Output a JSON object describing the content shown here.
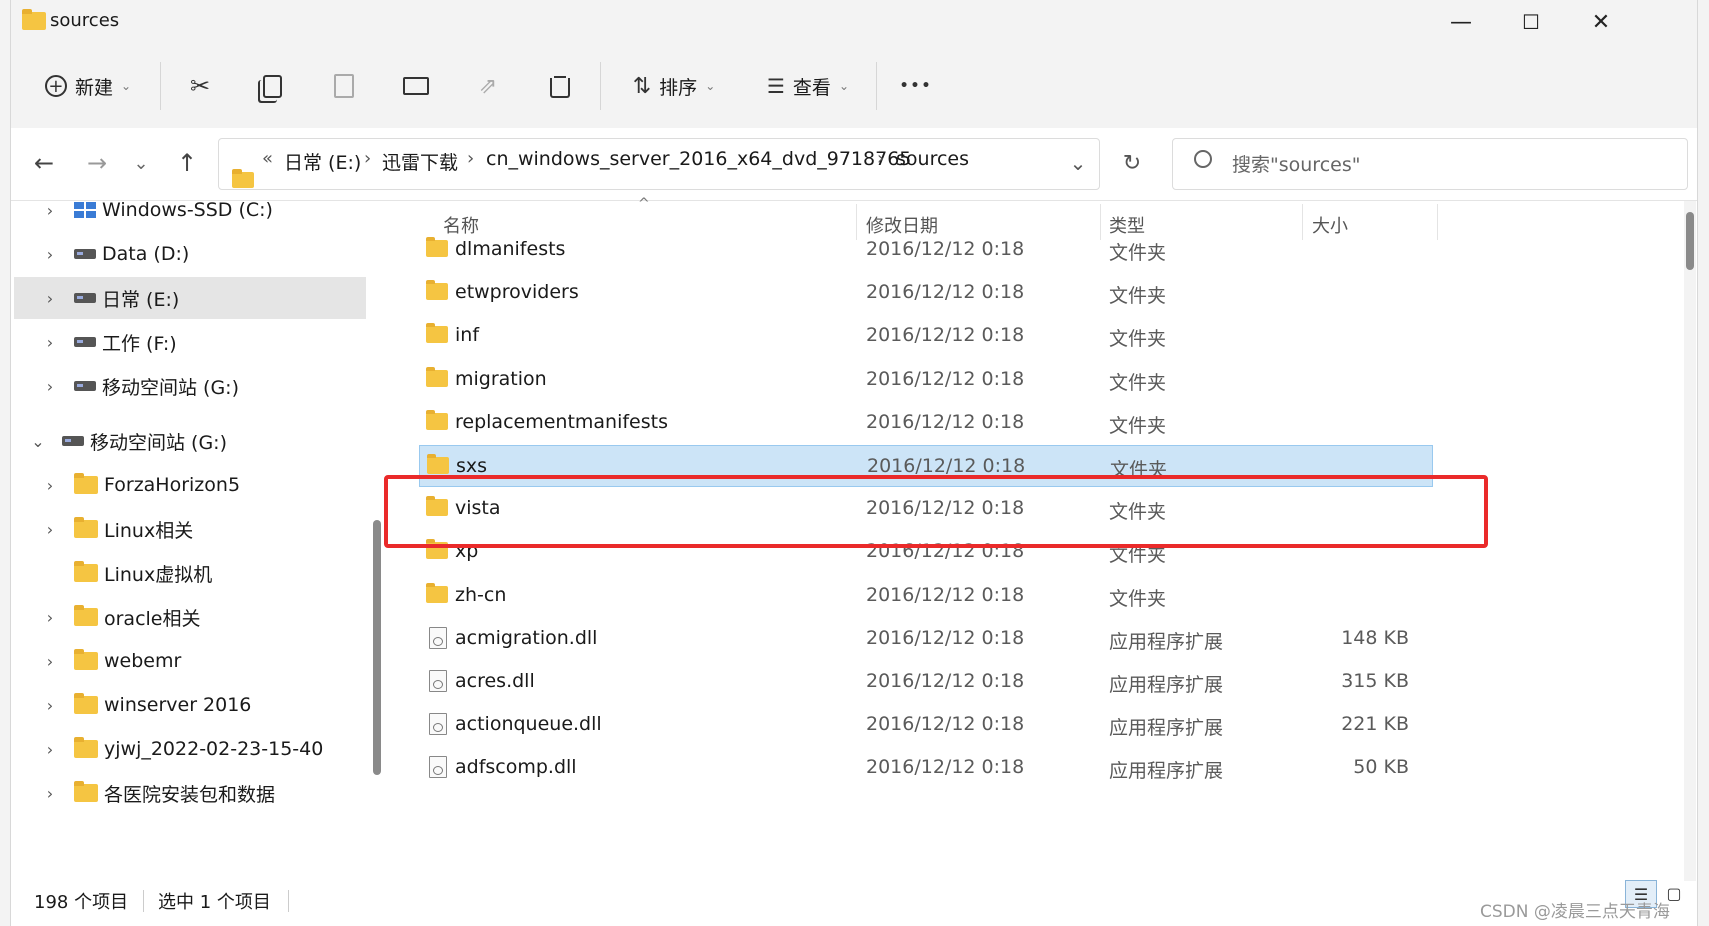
{
  "window": {
    "title": "sources",
    "minimize_glyph": "—",
    "maximize_glyph": "☐",
    "close_glyph": "✕"
  },
  "toolbar": {
    "new_label": "新建",
    "sort_label": "排序",
    "view_label": "查看",
    "more_glyph": "•••",
    "icons": [
      "plus-circle-icon",
      "cut-icon",
      "copy-icon",
      "paste-icon",
      "rename-icon",
      "share-icon",
      "delete-icon",
      "sort-icon",
      "view-icon",
      "more-icon"
    ]
  },
  "nav": {
    "back_glyph": "←",
    "forward_glyph": "→",
    "recent_glyph": "⌄",
    "up_glyph": "↑",
    "overflow": "«",
    "breadcrumbs": [
      "日常 (E:)",
      "迅雷下载",
      "cn_windows_server_2016_x64_dvd_9718765",
      "sources"
    ],
    "crumb_sep": "›",
    "dropdown_glyph": "⌄",
    "refresh_glyph": "↻"
  },
  "search": {
    "placeholder": "搜索\"sources\"",
    "icon": "search-icon"
  },
  "sidebar": {
    "items": [
      {
        "label": "Windows-SSD (C:)",
        "icon": "windows-drive-icon",
        "expander": "›",
        "selected": false
      },
      {
        "label": "Data (D:)",
        "icon": "drive-icon",
        "expander": "›",
        "selected": false
      },
      {
        "label": "日常 (E:)",
        "icon": "drive-icon",
        "expander": "›",
        "selected": true
      },
      {
        "label": "工作 (F:)",
        "icon": "drive-icon",
        "expander": "›",
        "selected": false
      },
      {
        "label": "移动空间站 (G:)",
        "icon": "drive-icon",
        "expander": "›",
        "selected": false
      },
      {
        "label": "移动空间站 (G:)",
        "icon": "drive-icon",
        "expander": "⌄",
        "selected": false
      },
      {
        "label": "ForzaHorizon5",
        "icon": "folder-icon",
        "expander": "›",
        "selected": false
      },
      {
        "label": "Linux相关",
        "icon": "folder-icon",
        "expander": "›",
        "selected": false
      },
      {
        "label": "Linux虚拟机",
        "icon": "folder-icon",
        "expander": "",
        "selected": false
      },
      {
        "label": "oracle相关",
        "icon": "folder-icon",
        "expander": "›",
        "selected": false
      },
      {
        "label": "webemr",
        "icon": "folder-icon",
        "expander": "›",
        "selected": false
      },
      {
        "label": "winserver 2016",
        "icon": "folder-icon",
        "expander": "›",
        "selected": false
      },
      {
        "label": "yjwj_2022-02-23-15-40",
        "icon": "folder-icon",
        "expander": "›",
        "selected": false
      },
      {
        "label": "各医院安装包和数据",
        "icon": "folder-icon",
        "expander": "›",
        "selected": false
      }
    ]
  },
  "columns": {
    "name": "名称",
    "date": "修改日期",
    "type": "类型",
    "size": "大小",
    "sort_glyph": "^"
  },
  "files": [
    {
      "name": "dlmanifests",
      "date": "2016/12/12 0:18",
      "type": "文件夹",
      "size": "",
      "kind": "folder",
      "selected": false
    },
    {
      "name": "etwproviders",
      "date": "2016/12/12 0:18",
      "type": "文件夹",
      "size": "",
      "kind": "folder",
      "selected": false
    },
    {
      "name": "inf",
      "date": "2016/12/12 0:18",
      "type": "文件夹",
      "size": "",
      "kind": "folder",
      "selected": false
    },
    {
      "name": "migration",
      "date": "2016/12/12 0:18",
      "type": "文件夹",
      "size": "",
      "kind": "folder",
      "selected": false
    },
    {
      "name": "replacementmanifests",
      "date": "2016/12/12 0:18",
      "type": "文件夹",
      "size": "",
      "kind": "folder",
      "selected": false
    },
    {
      "name": "sxs",
      "date": "2016/12/12 0:18",
      "type": "文件夹",
      "size": "",
      "kind": "folder",
      "selected": true
    },
    {
      "name": "vista",
      "date": "2016/12/12 0:18",
      "type": "文件夹",
      "size": "",
      "kind": "folder",
      "selected": false
    },
    {
      "name": "xp",
      "date": "2016/12/12 0:18",
      "type": "文件夹",
      "size": "",
      "kind": "folder",
      "selected": false
    },
    {
      "name": "zh-cn",
      "date": "2016/12/12 0:18",
      "type": "文件夹",
      "size": "",
      "kind": "folder",
      "selected": false
    },
    {
      "name": "acmigration.dll",
      "date": "2016/12/12 0:18",
      "type": "应用程序扩展",
      "size": "148 KB",
      "kind": "dll",
      "selected": false
    },
    {
      "name": "acres.dll",
      "date": "2016/12/12 0:18",
      "type": "应用程序扩展",
      "size": "315 KB",
      "kind": "dll",
      "selected": false
    },
    {
      "name": "actionqueue.dll",
      "date": "2016/12/12 0:18",
      "type": "应用程序扩展",
      "size": "221 KB",
      "kind": "dll",
      "selected": false
    },
    {
      "name": "adfscomp.dll",
      "date": "2016/12/12 0:18",
      "type": "应用程序扩展",
      "size": "50 KB",
      "kind": "dll",
      "selected": false
    }
  ],
  "status": {
    "count": "198 个项目",
    "selected": "选中 1 个项目",
    "details_view_glyph": "☰",
    "tiles_view_glyph": "▢"
  },
  "watermark": "CSDN @凌晨三点天青海",
  "colors": {
    "selection": "#cce4f7",
    "annotation": "#ea2a2a",
    "folder": "#f5c542"
  }
}
